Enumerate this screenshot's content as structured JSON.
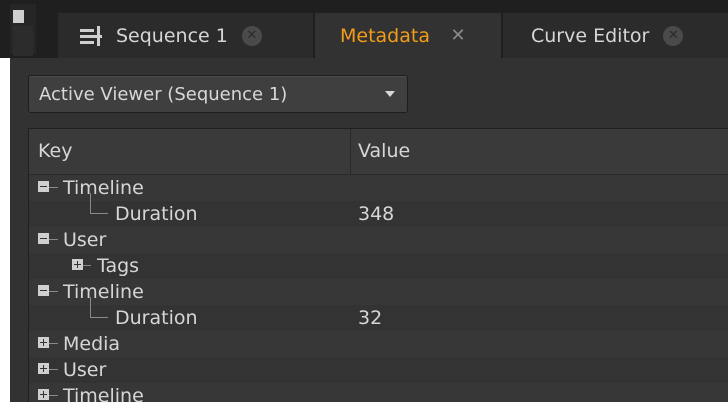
{
  "tabs": [
    {
      "label": "Sequence 1",
      "active": false
    },
    {
      "label": "Metadata",
      "active": true
    },
    {
      "label": "Curve Editor",
      "active": false
    }
  ],
  "viewer_dropdown": {
    "selected": "Active Viewer (Sequence 1)"
  },
  "table": {
    "columns": [
      "Key",
      "Value"
    ],
    "rows": [
      {
        "key": "Timeline",
        "value": "",
        "expander": "minus"
      },
      {
        "key": "Duration",
        "value": "348",
        "expander": ""
      },
      {
        "key": "User",
        "value": "",
        "expander": "minus"
      },
      {
        "key": "Tags",
        "value": "",
        "expander": "plus"
      },
      {
        "key": "Timeline",
        "value": "",
        "expander": "minus"
      },
      {
        "key": "Duration",
        "value": "32",
        "expander": ""
      },
      {
        "key": "Media",
        "value": "",
        "expander": "plus"
      },
      {
        "key": "User",
        "value": "",
        "expander": "plus"
      },
      {
        "key": "Timeline",
        "value": "",
        "expander": "plus"
      }
    ]
  },
  "colors": {
    "accent": "#f39c1a",
    "panel": "#323232",
    "tabbar": "#1f1f1f"
  }
}
